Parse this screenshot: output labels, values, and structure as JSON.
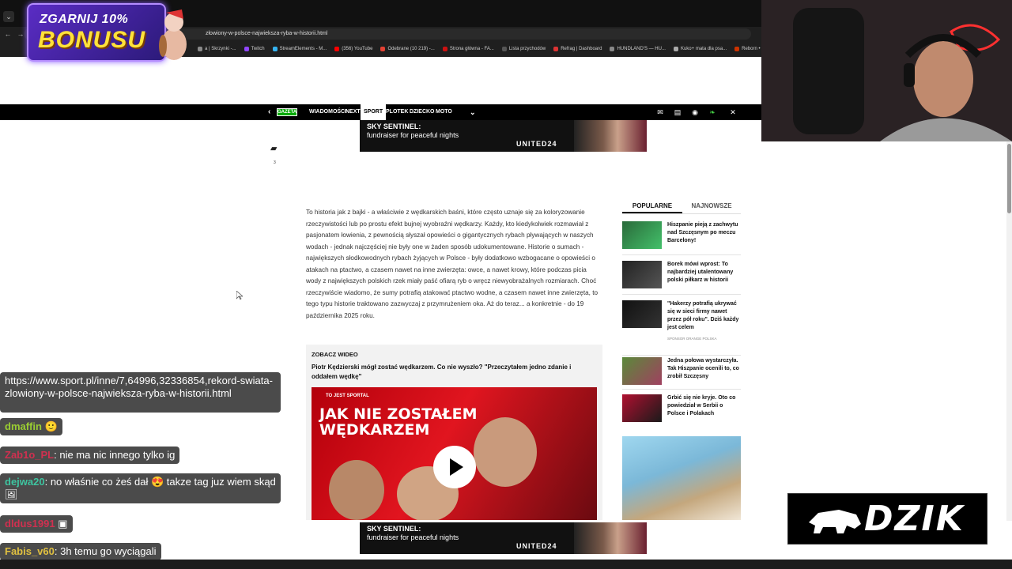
{
  "browser": {
    "url": "złowiony-w-polsce-najwieksza-ryba-w-historii.html",
    "bookmarks": [
      "a | Skrzynki -...",
      "Twitch",
      "StreamElements - M...",
      "(356) YouTube",
      "Odebrane (10 219) -...",
      "Strona główna - FA...",
      "Lista przychodów",
      "Refrag | Dashboard",
      "HUNDLAND'S — HU...",
      "Kuko+ mata dla psa...",
      "Reborn • The H..."
    ],
    "bookmark_colors": [
      "#8a8a8a",
      "#9146ff",
      "#35b3f0",
      "#ff0000",
      "#e34133",
      "#c11",
      "#555",
      "#d33",
      "#888",
      "#aaa",
      "#c30"
    ]
  },
  "bonus": {
    "top": "ZGARNIJ 10%",
    "main": "BONUSU"
  },
  "sitenav": {
    "logo": "GAZETA",
    "items": [
      "WIADOMOŚCI",
      "NEXT",
      "SPORT",
      "PLOTEK",
      "DZIECKO",
      "MOTO"
    ],
    "active": "SPORT"
  },
  "ad": {
    "line1": "SKY SENTINEL:",
    "line2": "fundraiser for peaceful nights",
    "brand": "UNITED24"
  },
  "comments": {
    "count": "3"
  },
  "article": {
    "body": "To historia jak z bajki - a właściwie z wędkarskich baśni, które często uznaje się za koloryzowanie rzeczywistości lub po prostu efekt bujnej wyobraźni wędkarzy. Każdy, kto kiedykolwiek rozmawiał z pasjonatem łowienia, z pewnością słyszał opowieści o gigantycznych rybach pływających w naszych wodach - jednak najczęściej nie były one w żaden sposób udokumentowane. Historie o sumach - największych słodkowodnych rybach żyjących w Polsce - były dodatkowo wzbogacane o opowieści o atakach na ptactwo, a czasem nawet na inne zwierzęta: owce, a nawet krowy, które podczas picia wody z największych polskich rzek miały paść ofiarą ryb o wręcz niewyobrażalnych rozmiarach. Choć rzeczywiście wiadomo, że sumy potrafią atakować ptactwo wodne, a czasem nawet inne zwierzęta, to tego typu historie traktowano zazwyczaj z przymrużeniem oka. Aż do teraz... a konkretnie - do 19 października 2025 roku."
  },
  "video": {
    "kicker": "ZOBACZ WIDEO",
    "title": "Piotr Kędzierski mógł zostać wędkarzem. Co nie wyszło? \"Przeczytałem jedno zdanie i oddałem wędkę\"",
    "brand": "TO JEST SPORTAL",
    "headline_1": "JAK NIE ZOSTAŁEM",
    "headline_2": "WĘDKARZEM"
  },
  "sidebar": {
    "tabs": [
      "POPULARNE",
      "NAJNOWSZE"
    ],
    "items": [
      {
        "title": "Hiszpanie pieją z zachwytu nad Szczęsnym po meczu Barcelony!"
      },
      {
        "title": "Borek mówi wprost: To najbardziej utalentowany polski piłkarz w historii"
      },
      {
        "title": "\"Hakerzy potrafią ukrywać się w sieci firmy nawet przez pół roku\". Dziś każdy jest celem"
      },
      {
        "title": "Jedna połowa wystarczyła. Tak Hiszpanie ocenili to, co zrobił Szczęsny"
      },
      {
        "title": "Grbić się nie kryje. Oto co powiedział w Serbii o Polsce i Polakach"
      }
    ],
    "sponsor": "SPONSOR ORANGE POLSKA"
  },
  "chat": [
    {
      "user": "",
      "text": "https://www.sport.pl/inne/7,64996,32336854,rekord-swiata-zlowiony-w-polsce-najwieksza-ryba-w-historii.html",
      "color": "#c33"
    },
    {
      "user": "dmaffin",
      "text": "",
      "color": "#9acd32"
    },
    {
      "user": "Zab1o_PL",
      "text": ": nie ma nic innego tylko ig",
      "color": "#d03050"
    },
    {
      "user": "dejwa20",
      "text": ": no właśnie co żeś dał 😍 takze tag juz wiem skąd 🖼",
      "color": "#3ec4a0"
    },
    {
      "user": "dldus1991",
      "text": "",
      "color": "#d03050"
    },
    {
      "user": "Fabis_v60",
      "text": ": 3h temu go wyciągali",
      "color": "#e0c040"
    }
  ],
  "dzik": {
    "text": "DZIK"
  }
}
